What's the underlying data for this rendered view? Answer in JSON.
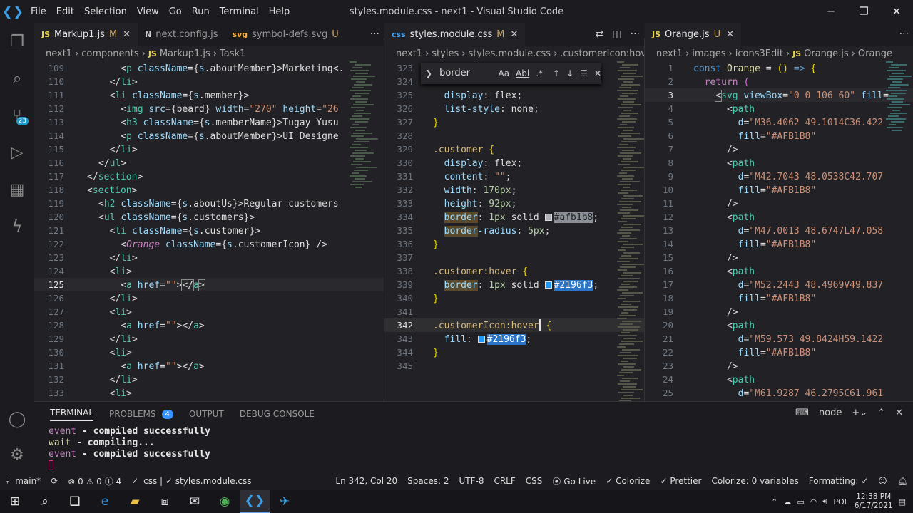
{
  "window": {
    "title": "styles.module.css - next1 - Visual Studio Code",
    "menu": [
      "File",
      "Edit",
      "Selection",
      "View",
      "Go",
      "Run",
      "Terminal",
      "Help"
    ]
  },
  "activity": {
    "scm_count": "23"
  },
  "left": {
    "tabs": [
      {
        "icon": "JS",
        "label": "Markup1.js",
        "mark": "M"
      },
      {
        "icon": "N",
        "label": "next.config.js",
        "mark": ""
      },
      {
        "icon": "svg",
        "label": "symbol-defs.svg",
        "mark": "U"
      }
    ],
    "crumbs": [
      "next1",
      "components",
      "JS",
      "Markup1.js",
      "Task1"
    ],
    "lines": [
      {
        "n": "109",
        "h": "    <span class=\"p\">&lt;</span><span class=\"t\">p</span> <span class=\"a\">className</span><span class=\"p\">={</span><span class=\"a\">s</span><span class=\"p\">.aboutMember}&gt;Marketing&lt;.</span>"
      },
      {
        "n": "110",
        "h": "  <span class=\"p\">&lt;/</span><span class=\"t\">li</span><span class=\"p\">&gt;</span>"
      },
      {
        "n": "111",
        "h": "  <span class=\"p\">&lt;</span><span class=\"t\">li</span> <span class=\"a\">className</span><span class=\"p\">={</span><span class=\"a\">s</span><span class=\"p\">.member}&gt;</span>"
      },
      {
        "n": "112",
        "h": "    <span class=\"p\">&lt;</span><span class=\"t\">img</span> <span class=\"a\">src</span><span class=\"p\">={beard}</span> <span class=\"a\">width</span><span class=\"p\">=</span><span class=\"s\">\"270\"</span> <span class=\"a\">height</span><span class=\"p\">=</span><span class=\"s\">\"26</span>"
      },
      {
        "n": "113",
        "h": "    <span class=\"p\">&lt;</span><span class=\"t\">h3</span> <span class=\"a\">className</span><span class=\"p\">={</span><span class=\"a\">s</span><span class=\"p\">.memberName}&gt;Tugay Yusu</span>"
      },
      {
        "n": "114",
        "h": "    <span class=\"p\">&lt;</span><span class=\"t\">p</span> <span class=\"a\">className</span><span class=\"p\">={</span><span class=\"a\">s</span><span class=\"p\">.aboutMember}&gt;UI Designe</span>"
      },
      {
        "n": "115",
        "h": "  <span class=\"p\">&lt;/</span><span class=\"t\">li</span><span class=\"p\">&gt;</span>"
      },
      {
        "n": "116",
        "h": "<span class=\"p\">&lt;/</span><span class=\"t\">ul</span><span class=\"p\">&gt;</span>"
      },
      {
        "n": "117",
        "h": "<span class=\"p\">&lt;/</span><span class=\"t\">section</span><span class=\"p\">&gt;</span>",
        "ind": -1
      },
      {
        "n": "118",
        "h": "<span class=\"p\">&lt;</span><span class=\"t\">section</span><span class=\"p\">&gt;</span>",
        "ind": -1
      },
      {
        "n": "119",
        "h": "<span class=\"p\">&lt;</span><span class=\"t\">h2</span> <span class=\"a\">className</span><span class=\"p\">={</span><span class=\"a\">s</span><span class=\"p\">.aboutUs}&gt;Regular customers</span>"
      },
      {
        "n": "120",
        "h": "<span class=\"p\">&lt;</span><span class=\"t\">ul</span> <span class=\"a\">className</span><span class=\"p\">={</span><span class=\"a\">s</span><span class=\"p\">.customers}&gt;</span>"
      },
      {
        "n": "121",
        "h": "  <span class=\"p\">&lt;</span><span class=\"t\">li</span> <span class=\"a\">className</span><span class=\"p\">={</span><span class=\"a\">s</span><span class=\"p\">.customer}&gt;</span>"
      },
      {
        "n": "122",
        "h": "    <span class=\"p\">&lt;</span><span class=\"i\">Orange</span> <span class=\"a\">className</span><span class=\"p\">={</span><span class=\"a\">s</span><span class=\"p\">.customerIcon} /&gt;</span>"
      },
      {
        "n": "123",
        "h": "  <span class=\"p\">&lt;/</span><span class=\"t\">li</span><span class=\"p\">&gt;</span>"
      },
      {
        "n": "124",
        "h": "  <span class=\"p\">&lt;</span><span class=\"t\">li</span><span class=\"p\">&gt;</span>"
      },
      {
        "n": "125",
        "h": "    <span class=\"p\">&lt;</span><span class=\"t\">a</span> <span class=\"a\">href</span><span class=\"p\">=</span><span class=\"s\">\"\"</span><span class=\"p\">&gt;</span><span class=\"p\" style=\"outline:1px solid #888\">&lt;/</span><span class=\"t\">a</span><span class=\"p\" style=\"outline:1px solid #888\">&gt;</span>",
        "cur": true
      },
      {
        "n": "126",
        "h": "  <span class=\"p\">&lt;/</span><span class=\"t\">li</span><span class=\"p\">&gt;</span>"
      },
      {
        "n": "127",
        "h": "  <span class=\"p\">&lt;</span><span class=\"t\">li</span><span class=\"p\">&gt;</span>"
      },
      {
        "n": "128",
        "h": "    <span class=\"p\">&lt;</span><span class=\"t\">a</span> <span class=\"a\">href</span><span class=\"p\">=</span><span class=\"s\">\"\"</span><span class=\"p\">&gt;&lt;/</span><span class=\"t\">a</span><span class=\"p\">&gt;</span>"
      },
      {
        "n": "129",
        "h": "  <span class=\"p\">&lt;/</span><span class=\"t\">li</span><span class=\"p\">&gt;</span>"
      },
      {
        "n": "130",
        "h": "  <span class=\"p\">&lt;</span><span class=\"t\">li</span><span class=\"p\">&gt;</span>"
      },
      {
        "n": "131",
        "h": "    <span class=\"p\">&lt;</span><span class=\"t\">a</span> <span class=\"a\">href</span><span class=\"p\">=</span><span class=\"s\">\"\"</span><span class=\"p\">&gt;&lt;/</span><span class=\"t\">a</span><span class=\"p\">&gt;</span>"
      },
      {
        "n": "132",
        "h": "  <span class=\"p\">&lt;/</span><span class=\"t\">li</span><span class=\"p\">&gt;</span>"
      },
      {
        "n": "133",
        "h": "  <span class=\"p\">&lt;</span><span class=\"t\">li</span><span class=\"p\">&gt;</span>"
      }
    ]
  },
  "mid": {
    "tabs": [
      {
        "icon": "css",
        "label": "styles.module.css",
        "mark": "M"
      }
    ],
    "crumbs": [
      "next1",
      "styles",
      "styles.module.css",
      ".customerIcon:hove"
    ],
    "find": {
      "value": "border",
      "opts": [
        "Aa",
        "Abl",
        ".*"
      ]
    },
    "lines": [
      {
        "n": "323",
        "h": ""
      },
      {
        "n": "324",
        "h": ""
      },
      {
        "n": "325",
        "h": "  <span class=\"prop\">display</span>: <span class=\"p\">flex;</span>"
      },
      {
        "n": "326",
        "h": "  <span class=\"prop\">list-style</span>: <span class=\"p\">none;</span>"
      },
      {
        "n": "327",
        "h": "<span class=\"br\">}</span>"
      },
      {
        "n": "328",
        "h": ""
      },
      {
        "n": "329",
        "h": "<span class=\"sel\">.customer</span> <span class=\"br\">{</span>"
      },
      {
        "n": "330",
        "h": "  <span class=\"prop\">display</span>: <span class=\"p\">flex;</span>"
      },
      {
        "n": "331",
        "h": "  <span class=\"prop\">content</span>: <span class=\"str\">\"\"</span><span class=\"p\">;</span>"
      },
      {
        "n": "332",
        "h": "  <span class=\"prop\">width</span>: <span class=\"num\">170px</span><span class=\"p\">;</span>"
      },
      {
        "n": "333",
        "h": "  <span class=\"prop\">height</span>: <span class=\"num\">92px</span><span class=\"p\">;</span>"
      },
      {
        "n": "334",
        "h": "  <span class=\"prop hl\">border</span>: <span class=\"num\">1px</span> <span class=\"p\">solid</span> <span class=\"chip\" style=\"background:#afb1b8\"></span><span class=\"hexg\">#afb1b8</span><span class=\"p\">;</span>"
      },
      {
        "n": "335",
        "h": "  <span class=\"prop hl\">border</span><span class=\"prop\">-radius</span>: <span class=\"num\">5px</span><span class=\"p\">;</span>"
      },
      {
        "n": "336",
        "h": "<span class=\"br\">}</span>"
      },
      {
        "n": "337",
        "h": ""
      },
      {
        "n": "338",
        "h": "<span class=\"sel\">.customer:hover</span> <span class=\"br\">{</span>"
      },
      {
        "n": "339",
        "h": "  <span class=\"prop hl\">border</span>: <span class=\"num\">1px</span> <span class=\"p\">solid</span> <span class=\"chip\" style=\"background:#2196f3\"></span><span class=\"hexs\">#2196f3</span><span class=\"p\">;</span>"
      },
      {
        "n": "340",
        "h": "<span class=\"br\">}</span>"
      },
      {
        "n": "341",
        "h": ""
      },
      {
        "n": "342",
        "h": "<span class=\"sel\">.customerIcon:hover</span><span class=\"caret\"></span> <span class=\"br\">{</span>",
        "cur": true
      },
      {
        "n": "343",
        "h": "  <span class=\"prop\">fill</span>: <span class=\"chip\" style=\"background:#2196f3\"></span><span class=\"hexs\">#2196f3</span><span class=\"p\">;</span>"
      },
      {
        "n": "344",
        "h": "<span class=\"br\">}</span>"
      },
      {
        "n": "345",
        "h": ""
      }
    ]
  },
  "right": {
    "tabs": [
      {
        "icon": "JS",
        "label": "Orange.js",
        "mark": "U"
      }
    ],
    "crumbs": [
      "next1",
      "images",
      "icons3Edit",
      "JS",
      "Orange.js",
      "Orange"
    ],
    "lines": [
      {
        "n": "1",
        "h": "<span class=\"k\">const</span> <span class=\"a\" style=\"color:#dcdcaa\">Orange</span> <span class=\"p\">=</span> <span class=\"br\">()</span> <span class=\"k\">=&gt;</span> <span class=\"br\">{</span>"
      },
      {
        "n": "2",
        "h": "  <span class=\"i\" style=\"font-style:normal\">return</span> <span class=\"i\" style=\"font-style:normal;color:#da70d6\">(</span>"
      },
      {
        "n": "3",
        "h": "    <span class=\"p\" style=\"outline:1px solid #888\">&lt;</span><span class=\"t\">svg</span> <span class=\"a\">viewBox</span><span class=\"p\">=</span><span class=\"s\">\"0 0 106 60\"</span> <span class=\"a\">fill</span><span class=\"p\">=</span>",
        "cur": true
      },
      {
        "n": "4",
        "h": "      <span class=\"p\">&lt;</span><span class=\"t\">path</span>"
      },
      {
        "n": "5",
        "h": "        <span class=\"a\">d</span><span class=\"p\">=</span><span class=\"s\">\"M36.4062 49.1014C36.422</span>"
      },
      {
        "n": "6",
        "h": "        <span class=\"a\">fill</span><span class=\"p\">=</span><span class=\"s\">\"#AFB1B8\"</span>"
      },
      {
        "n": "7",
        "h": "      <span class=\"p\">/&gt;</span>"
      },
      {
        "n": "8",
        "h": "      <span class=\"p\">&lt;</span><span class=\"t\">path</span>"
      },
      {
        "n": "9",
        "h": "        <span class=\"a\">d</span><span class=\"p\">=</span><span class=\"s\">\"M42.7043 48.0538C42.707</span>"
      },
      {
        "n": "10",
        "h": "        <span class=\"a\">fill</span><span class=\"p\">=</span><span class=\"s\">\"#AFB1B8\"</span>"
      },
      {
        "n": "11",
        "h": "      <span class=\"p\">/&gt;</span>"
      },
      {
        "n": "12",
        "h": "      <span class=\"p\">&lt;</span><span class=\"t\">path</span>"
      },
      {
        "n": "13",
        "h": "        <span class=\"a\">d</span><span class=\"p\">=</span><span class=\"s\">\"M47.0013 48.6747L47.058</span>"
      },
      {
        "n": "14",
        "h": "        <span class=\"a\">fill</span><span class=\"p\">=</span><span class=\"s\">\"#AFB1B8\"</span>"
      },
      {
        "n": "15",
        "h": "      <span class=\"p\">/&gt;</span>"
      },
      {
        "n": "16",
        "h": "      <span class=\"p\">&lt;</span><span class=\"t\">path</span>"
      },
      {
        "n": "17",
        "h": "        <span class=\"a\">d</span><span class=\"p\">=</span><span class=\"s\">\"M52.2443 48.4969V49.837</span>"
      },
      {
        "n": "18",
        "h": "        <span class=\"a\">fill</span><span class=\"p\">=</span><span class=\"s\">\"#AFB1B8\"</span>"
      },
      {
        "n": "19",
        "h": "      <span class=\"p\">/&gt;</span>"
      },
      {
        "n": "20",
        "h": "      <span class=\"p\">&lt;</span><span class=\"t\">path</span>"
      },
      {
        "n": "21",
        "h": "        <span class=\"a\">d</span><span class=\"p\">=</span><span class=\"s\">\"M59.573 49.8424H59.1422</span>"
      },
      {
        "n": "22",
        "h": "        <span class=\"a\">fill</span><span class=\"p\">=</span><span class=\"s\">\"#AFB1B8\"</span>"
      },
      {
        "n": "23",
        "h": "      <span class=\"p\">/&gt;</span>"
      },
      {
        "n": "24",
        "h": "      <span class=\"p\">&lt;</span><span class=\"t\">path</span>"
      },
      {
        "n": "25",
        "h": "        <span class=\"a\">d</span><span class=\"p\">=</span><span class=\"s\">\"M61.9287 46.2795C61.961</span>"
      }
    ]
  },
  "panel": {
    "tabs": [
      "TERMINAL",
      "PROBLEMS",
      "OUTPUT",
      "DEBUG CONSOLE"
    ],
    "problems_count": "4",
    "shell": "node",
    "terminal": [
      {
        "tag": "event",
        "msg": "- compiled successfully"
      },
      {
        "tag": "wait ",
        "msg": "- compiling..."
      },
      {
        "tag": "event",
        "msg": "- compiled successfully"
      }
    ]
  },
  "status": {
    "branch": "main*",
    "errors": "0",
    "warnings": "0",
    "infos": "4",
    "breadcrumb": "css | ✓ styles.module.css",
    "position": "Ln 342, Col 20",
    "spaces": "Spaces: 2",
    "encoding": "UTF-8",
    "eol": "CRLF",
    "lang": "CSS",
    "golive": "Go Live",
    "colorize": "Colorize",
    "prettier": "Prettier",
    "colorize_vars": "Colorize: 0 variables",
    "formatting": "Formatting: ✓"
  },
  "taskbar": {
    "lang": "POL",
    "time": "12:38 PM",
    "date": "6/17/2021"
  }
}
